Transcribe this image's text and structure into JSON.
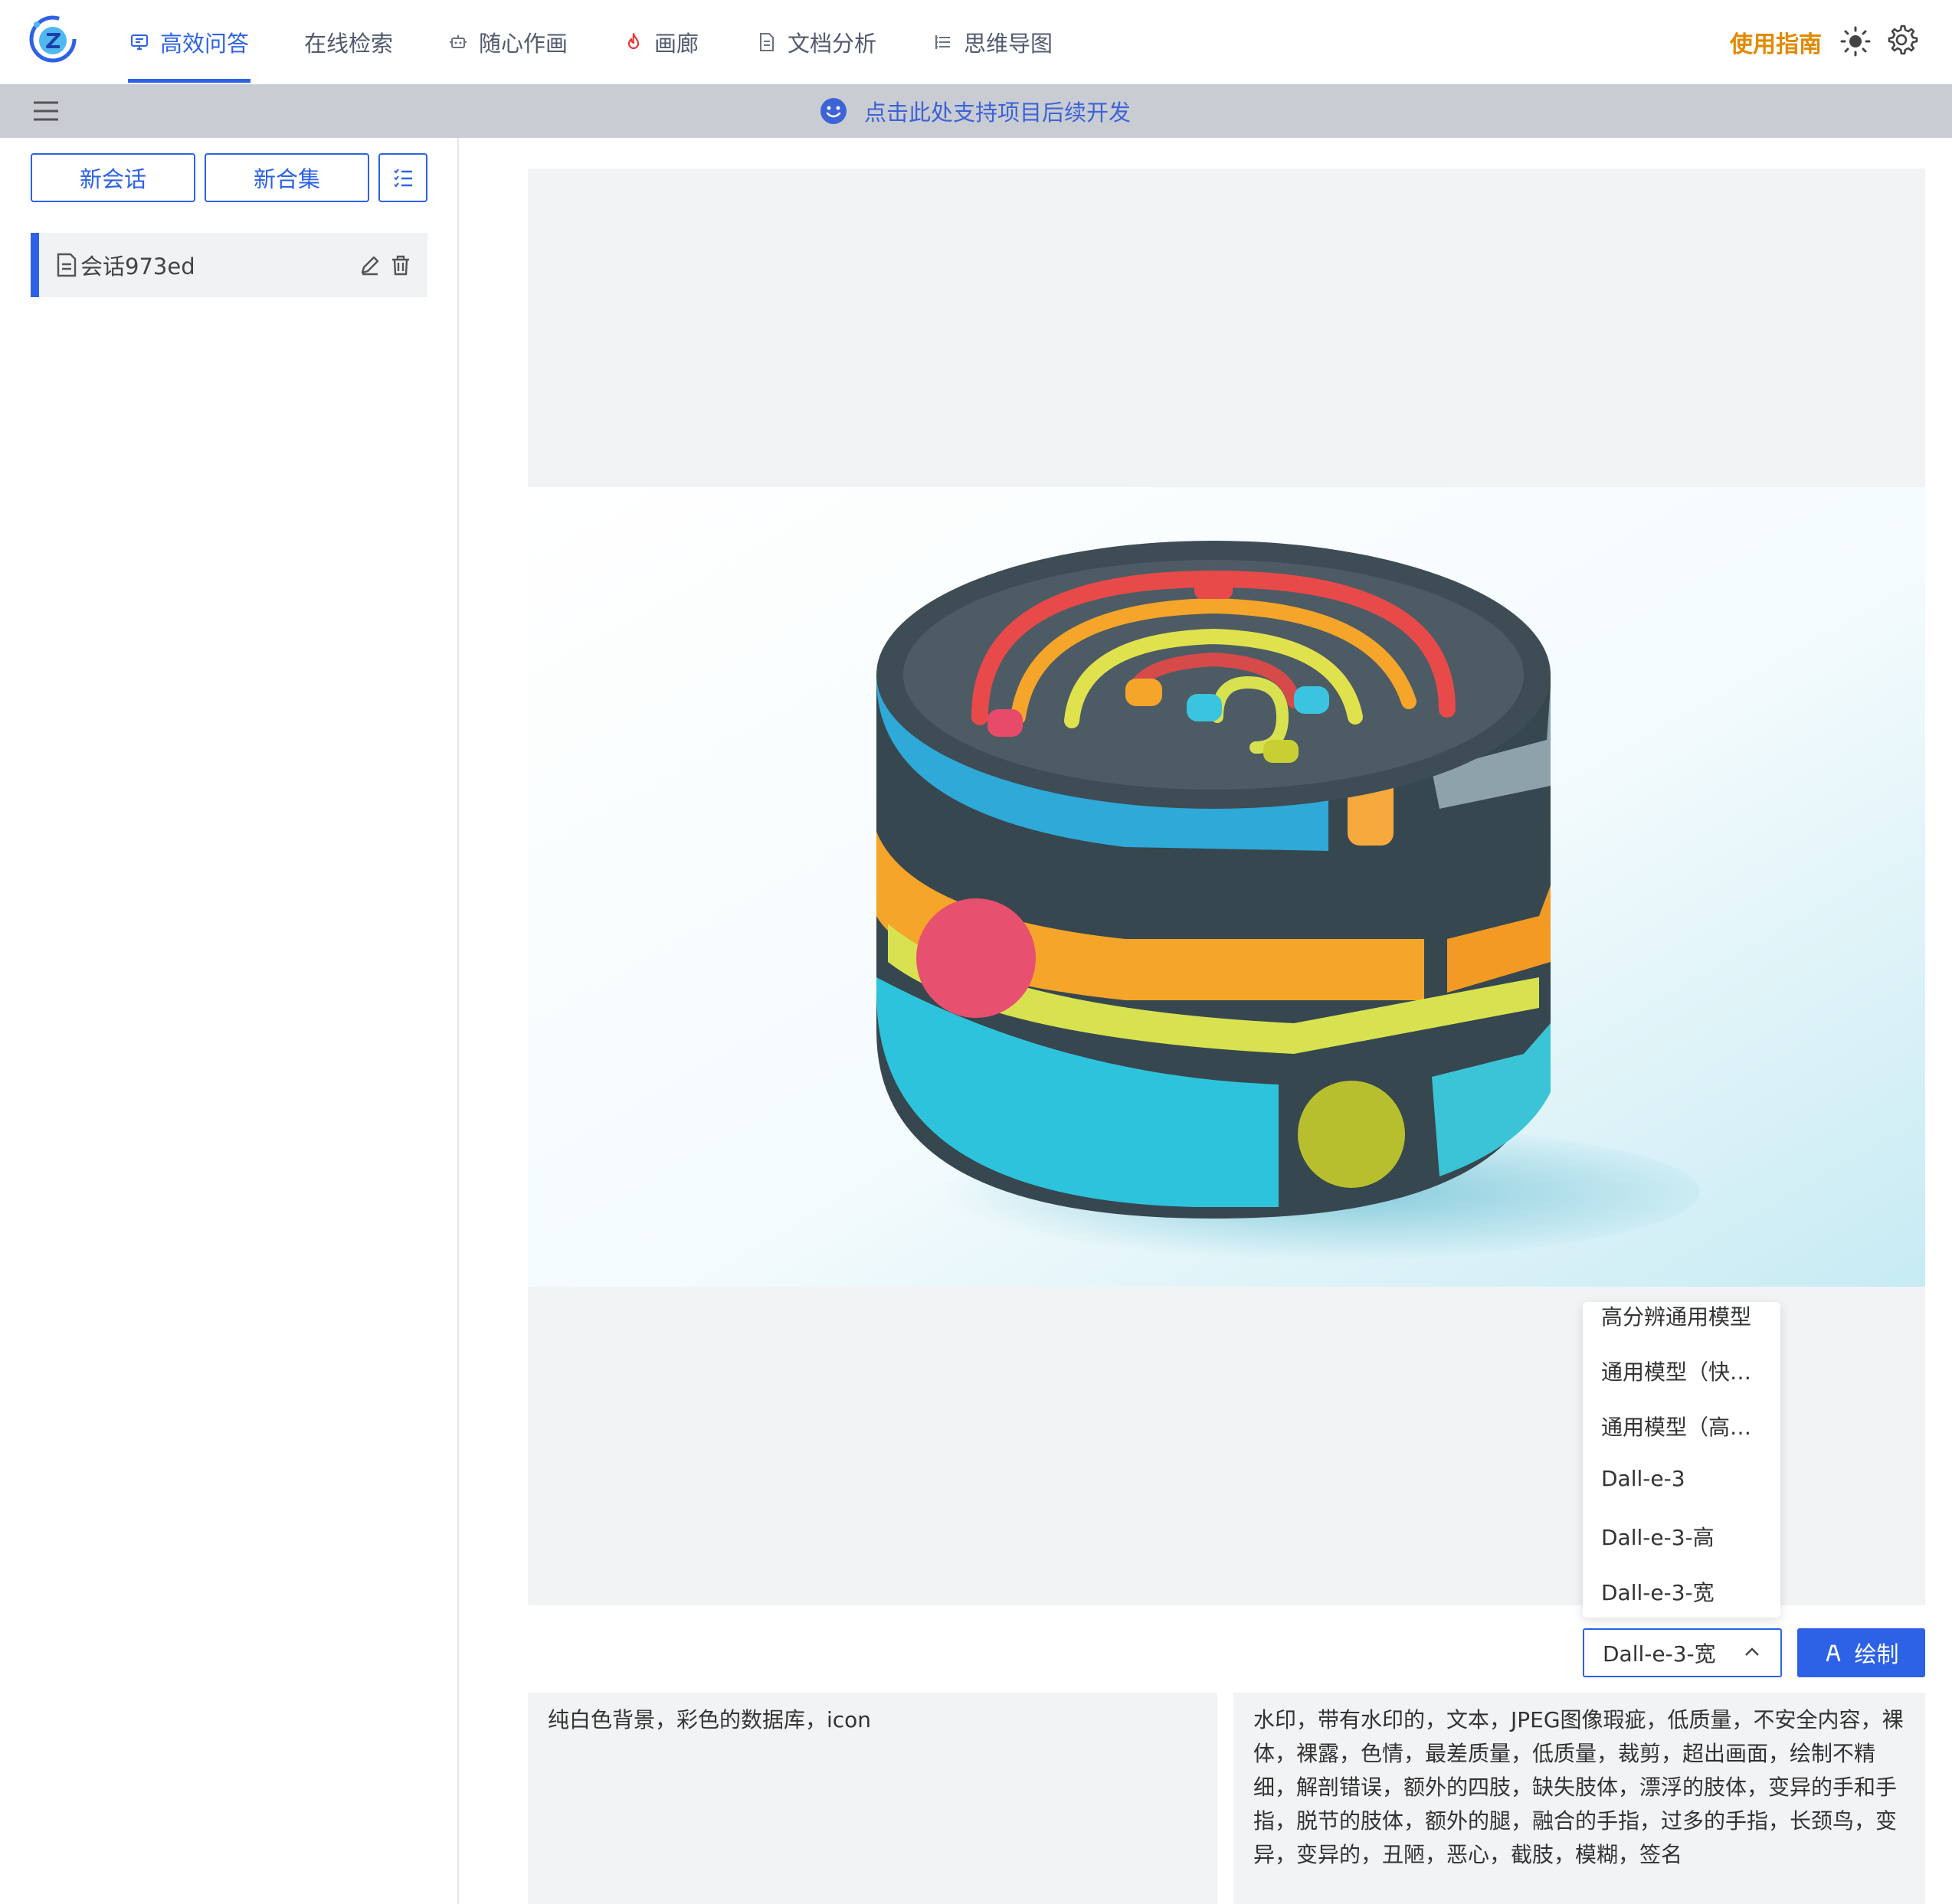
{
  "nav": {
    "tabs": [
      {
        "label": "高效问答",
        "icon": "chat-monitor-icon",
        "active": true
      },
      {
        "label": "在线检索",
        "icon": "",
        "active": false
      },
      {
        "label": "随心作画",
        "icon": "robot-icon",
        "active": false
      },
      {
        "label": "画廊",
        "icon": "fire-icon",
        "active": false
      },
      {
        "label": "文档分析",
        "icon": "document-icon",
        "active": false
      },
      {
        "label": "思维导图",
        "icon": "mindmap-list-icon",
        "active": false
      }
    ],
    "guide_label": "使用指南",
    "accent_color": "#2d62e6",
    "guide_color": "#e08a00",
    "fire_color": "#e53935"
  },
  "banner": {
    "text": "点击此处支持项目后续开发"
  },
  "sidebar": {
    "new_chat_label": "新会话",
    "new_collection_label": "新合集",
    "sessions": [
      {
        "title": "会话973ed"
      }
    ]
  },
  "draw": {
    "model_options": [
      "高分辨通用模型",
      "通用模型（快速）",
      "通用模型（高清）",
      "Dall-e-3",
      "Dall-e-3-高",
      "Dall-e-3-宽"
    ],
    "selected_model": "Dall-e-3-宽",
    "draw_button_label": "绘制",
    "prompt": "纯白色背景，彩色的数据库，icon",
    "negative_prompt": "水印，带有水印的，文本，JPEG图像瑕疵，低质量，不安全内容，裸体，裸露，色情，最差质量，低质量，裁剪，超出画面，绘制不精细，解剖错误，额外的四肢，缺失肢体，漂浮的肢体，变异的手和手指，脱节的肢体，额外的腿，融合的手指，过多的手指，长颈鸟，变异，变异的，丑陋，恶心，截肢，模糊，签名"
  }
}
